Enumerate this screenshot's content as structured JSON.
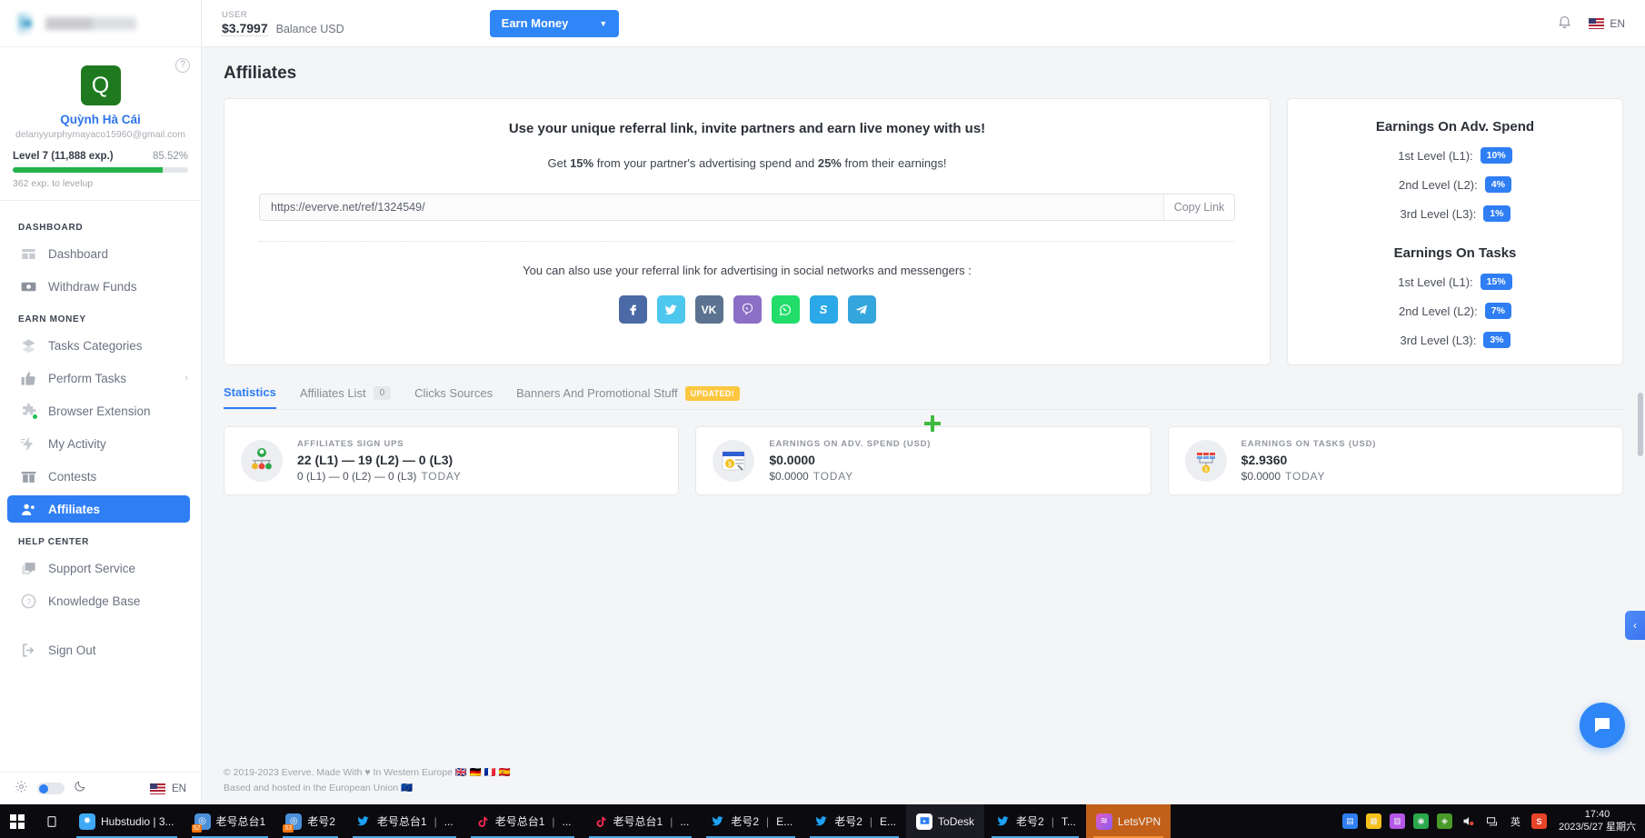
{
  "sidebar": {
    "profile": {
      "avatar_letter": "Q",
      "name": "Quỳnh Hà Cái",
      "email": "delanyyurphymayaco15960@gmail.com",
      "level_label": "Level 7 (11,888 exp.)",
      "level_percent": "85.52%",
      "level_note": "362 exp. to levelup",
      "help_icon": "question-circle-icon"
    },
    "sections": [
      {
        "title": "DASHBOARD",
        "items": [
          {
            "label": "Dashboard",
            "icon": "dashboard-icon",
            "active": false
          },
          {
            "label": "Withdraw Funds",
            "icon": "wallet-icon",
            "active": false
          }
        ]
      },
      {
        "title": "EARN MONEY",
        "items": [
          {
            "label": "Tasks Categories",
            "icon": "layers-icon",
            "active": false
          },
          {
            "label": "Perform Tasks",
            "icon": "thumbs-up-icon",
            "active": false,
            "chevron": "›"
          },
          {
            "label": "Browser Extension",
            "icon": "puzzle-icon",
            "active": false,
            "dot": true
          },
          {
            "label": "My Activity",
            "icon": "activity-icon",
            "active": false
          },
          {
            "label": "Contests",
            "icon": "gift-icon",
            "active": false
          },
          {
            "label": "Affiliates",
            "icon": "people-icon",
            "active": true
          }
        ]
      },
      {
        "title": "HELP CENTER",
        "items": [
          {
            "label": "Support Service",
            "icon": "chat-icon",
            "active": false
          },
          {
            "label": "Knowledge Base",
            "icon": "question-icon",
            "active": false
          }
        ]
      },
      {
        "title": "",
        "items": [
          {
            "label": "Sign Out",
            "icon": "logout-icon",
            "active": false
          }
        ]
      }
    ],
    "footer": {
      "gear_icon": "gear-icon",
      "theme_toggle": "theme-toggle",
      "moon_icon": "moon-icon",
      "flag_icon": "us-flag-icon",
      "language": "EN"
    }
  },
  "topbar": {
    "user_caption": "USER",
    "balance_amount": "$3.7997",
    "balance_label": "Balance USD",
    "earn_button": "Earn Money",
    "earn_caret": "▼",
    "bell_icon": "bell-icon",
    "flag_icon": "us-flag-icon",
    "language": "EN"
  },
  "main": {
    "page_title": "Affiliates",
    "promo": {
      "headline": "Use your unique referral link, invite partners and earn live money with us!",
      "sub_pre": "Get ",
      "sub_b1": "15%",
      "sub_mid": " from your partner's advertising spend and ",
      "sub_b2": "25%",
      "sub_post": " from their earnings!",
      "ref_link": "https://everve.net/ref/1324549/",
      "copy_label": "Copy Link",
      "social_caption": "You can also use your referral link for advertising in social networks and messengers :",
      "socials": [
        {
          "name": "facebook-icon",
          "glyph": "f",
          "color": "#4a69a5"
        },
        {
          "name": "twitter-icon",
          "glyph": "🐦",
          "color": "#4ec7ef"
        },
        {
          "name": "vk-icon",
          "glyph": "VK",
          "color": "#5b7390"
        },
        {
          "name": "viber-icon",
          "glyph": "◎",
          "color": "#8b6fc4"
        },
        {
          "name": "whatsapp-icon",
          "glyph": "◔",
          "color": "#22dd6a"
        },
        {
          "name": "skype-icon",
          "glyph": "S",
          "color": "#2aa8e8"
        },
        {
          "name": "telegram-icon",
          "glyph": "➤",
          "color": "#35a5dd"
        }
      ]
    },
    "rates": {
      "adv_title": "Earnings On Adv. Spend",
      "adv_rows": [
        {
          "label": "1st Level (L1):",
          "value": "10%"
        },
        {
          "label": "2nd Level (L2):",
          "value": "4%"
        },
        {
          "label": "3rd Level (L3):",
          "value": "1%"
        }
      ],
      "tasks_title": "Earnings On Tasks",
      "tasks_rows": [
        {
          "label": "1st Level (L1):",
          "value": "15%"
        },
        {
          "label": "2nd Level (L2):",
          "value": "7%"
        },
        {
          "label": "3rd Level (L3):",
          "value": "3%"
        }
      ]
    },
    "tabs": [
      {
        "label": "Statistics",
        "active": true
      },
      {
        "label": "Affiliates List",
        "active": false,
        "count": "0"
      },
      {
        "label": "Clicks Sources",
        "active": false
      },
      {
        "label": "Banners And Promotional Stuff",
        "active": false,
        "badge": "UPDATED!"
      }
    ],
    "stats": [
      {
        "caption": "AFFILIATES SIGN UPS",
        "value": "22 (L1) — 19 (L2) — 0 (L3)",
        "sub": "0 (L1) — 0 (L2) — 0 (L3)",
        "sub_tag": "TODAY",
        "icon": "affiliates-signups-icon"
      },
      {
        "caption": "EARNINGS ON ADV. SPEND (USD)",
        "value": "$0.0000",
        "sub": "$0.0000",
        "sub_tag": "TODAY",
        "icon": "adv-spend-icon"
      },
      {
        "caption": "EARNINGS ON TASKS (USD)",
        "value": "$2.9360",
        "sub": "$0.0000",
        "sub_tag": "TODAY",
        "icon": "tasks-earnings-icon"
      }
    ],
    "footer_line1": "© 2019-2023 Everve. Made With ♥ In Western Europe 🇬🇧 🇩🇪 🇫🇷 🇪🇸",
    "footer_line2": "Based and hosted in the European Union 🇪🇺",
    "side_tab_icon": "chevron-left-icon",
    "chat_icon": "chat-bubble-icon"
  },
  "taskbar": {
    "start_icon": "windows-start-icon",
    "taskview_icon": "task-view-icon",
    "items": [
      {
        "label": "Hubstudio | 3...",
        "icon": "hubstudio-icon",
        "color": "#3fa9f5",
        "underline": true
      },
      {
        "label": "老号总台1",
        "icon": "chrome-icon",
        "color": "#4a90d9",
        "badge": "52",
        "underline": true
      },
      {
        "label": "老号2",
        "icon": "chrome-icon",
        "color": "#4a90d9",
        "badge": "53",
        "underline": true
      },
      {
        "label": "老号总台1",
        "icon": "twitter-icon",
        "color": "#1da1f2",
        "sep": "|",
        "extra": "...",
        "underline": true
      },
      {
        "label": "老号总台1",
        "icon": "tiktok-icon",
        "color": "#111111",
        "sep": "|",
        "extra": "...",
        "underline": true
      },
      {
        "label": "老号总台1",
        "icon": "tiktok-icon",
        "color": "#111111",
        "sep": "|",
        "extra": "...",
        "underline": true
      },
      {
        "label": "老号2",
        "icon": "twitter-icon",
        "color": "#1da1f2",
        "sep": "|",
        "extra": "E...",
        "underline": true
      },
      {
        "label": "老号2",
        "icon": "twitter-icon",
        "color": "#1da1f2",
        "sep": "|",
        "extra": "E...",
        "underline": true
      },
      {
        "label": "ToDesk",
        "icon": "todesk-icon",
        "color": "#2f7ef4",
        "todesk": true
      },
      {
        "label": "老号2",
        "icon": "twitter-icon",
        "color": "#1da1f2",
        "sep": "|",
        "extra": "T...",
        "underline": true
      },
      {
        "label": "LetsVPN",
        "icon": "letsvpn-icon",
        "color": "#b457e8",
        "active": true,
        "underline": true
      }
    ],
    "tray": [
      {
        "name": "tray-app-1",
        "glyph": "▤",
        "color": "#2f7ef4"
      },
      {
        "name": "tray-app-2",
        "glyph": "▦",
        "color": "#f3c01c"
      },
      {
        "name": "tray-app-3",
        "glyph": "▥",
        "color": "#b457e8"
      },
      {
        "name": "tray-app-4",
        "glyph": "◉",
        "color": "#2aa84a"
      },
      {
        "name": "tray-app-5",
        "glyph": "◈",
        "color": "#4a9a2a"
      },
      {
        "name": "volume-icon",
        "glyph": "🔊",
        "color": "transparent"
      },
      {
        "name": "network-icon",
        "glyph": "🖵",
        "color": "transparent"
      },
      {
        "name": "ime-icon",
        "glyph": "英",
        "color": "transparent"
      },
      {
        "name": "sogou-icon",
        "glyph": "S",
        "color": "#e8442a"
      }
    ],
    "time": "17:40",
    "date": "2023/5/27 星期六"
  }
}
